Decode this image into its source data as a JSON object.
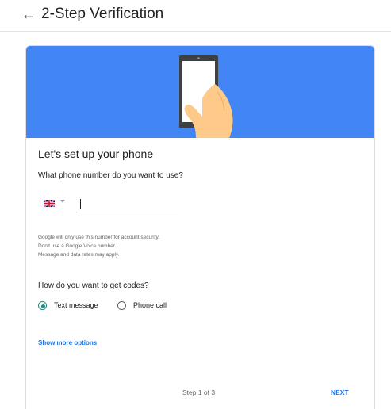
{
  "header": {
    "back_icon": "arrow-back-icon",
    "title": "2-Step Verification"
  },
  "card": {
    "illustration": "phone-in-hand-illustration",
    "title": "Let's set up your phone",
    "phone_question": "What phone number do you want to use?",
    "country": {
      "flag_icon": "uk-flag-icon",
      "dropdown_icon": "caret-down-icon"
    },
    "phone_input": {
      "value": "",
      "placeholder": ""
    },
    "notes": [
      "Google will only use this number for account security.",
      "Don't use a Google Voice number.",
      "Message and data rates may apply."
    ],
    "codes_question": "How do you want to get codes?",
    "options": [
      {
        "label": "Text message",
        "selected": true
      },
      {
        "label": "Phone call",
        "selected": false
      }
    ],
    "more_options": "Show more options",
    "step": "Step 1 of 3",
    "next": "NEXT"
  },
  "colors": {
    "banner": "#4285f4",
    "link": "#1a73e8",
    "radio_selected": "#1a8f7a"
  }
}
